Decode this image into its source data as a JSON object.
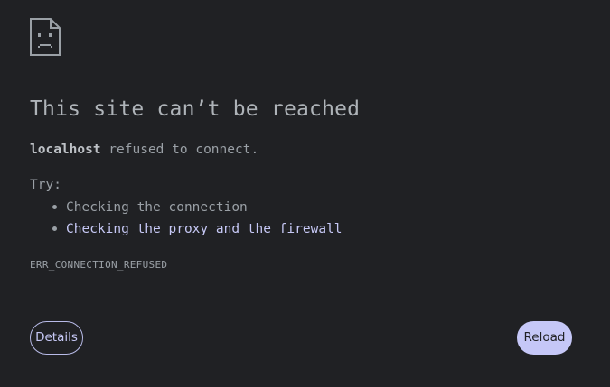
{
  "error_page": {
    "icon": "sad-page-icon",
    "title": "This site can’t be reached",
    "host": "localhost",
    "message_rest": " refused to connect.",
    "try_label": "Try:",
    "suggestions": [
      {
        "text": "Checking the connection"
      },
      {
        "text": "Checking the proxy and the firewall"
      }
    ],
    "error_code": "ERR_CONNECTION_REFUSED",
    "details_label": "Details",
    "reload_label": "Reload"
  },
  "colors": {
    "background": "#202124",
    "text": "#9aa0a6",
    "link": "#c6c8f5",
    "reload_button": "#c5c7f7"
  }
}
